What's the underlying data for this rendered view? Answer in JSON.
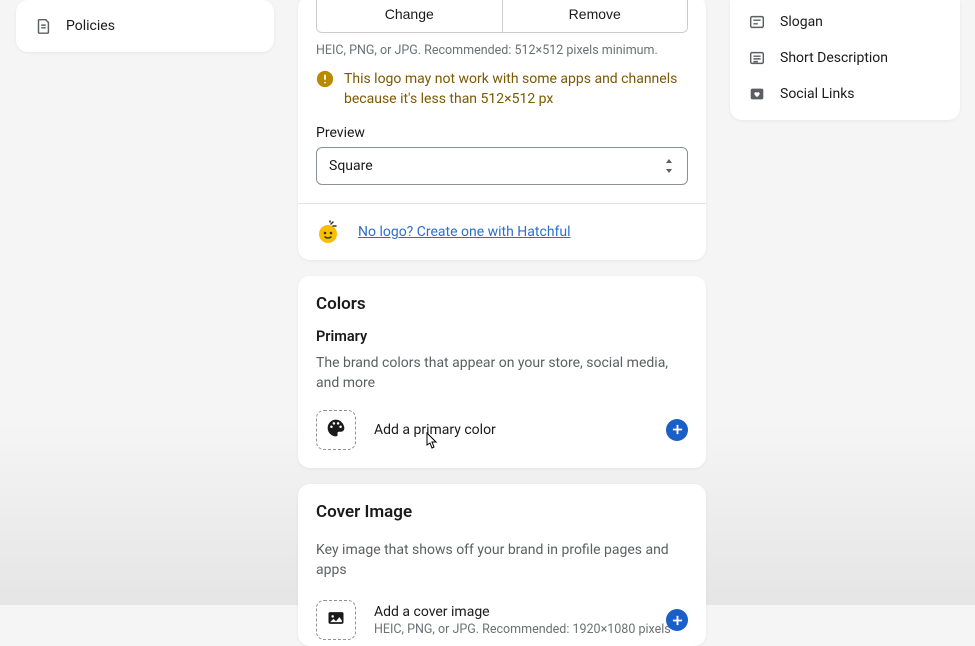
{
  "leftnav": {
    "policies": "Policies"
  },
  "logo_card": {
    "change": "Change",
    "remove": "Remove",
    "hint": "HEIC, PNG, or JPG. Recommended: 512×512 pixels minimum.",
    "warning": "This logo may not work with some apps and channels because it's less than 512×512 px",
    "preview_label": "Preview",
    "preview_value": "Square",
    "hatchful_link": "No logo? Create one with Hatchful"
  },
  "colors_card": {
    "title": "Colors",
    "subhead": "Primary",
    "desc": "The brand colors that appear on your store, social media, and more",
    "add_label": "Add a primary color"
  },
  "cover_card": {
    "title": "Cover Image",
    "desc": "Key image that shows off your brand in profile pages and apps",
    "add_label": "Add a cover image",
    "add_hint": "HEIC, PNG, or JPG. Recommended: 1920×1080 pixels"
  },
  "right": {
    "slogan": "Slogan",
    "short_desc": "Short Description",
    "social": "Social Links"
  }
}
